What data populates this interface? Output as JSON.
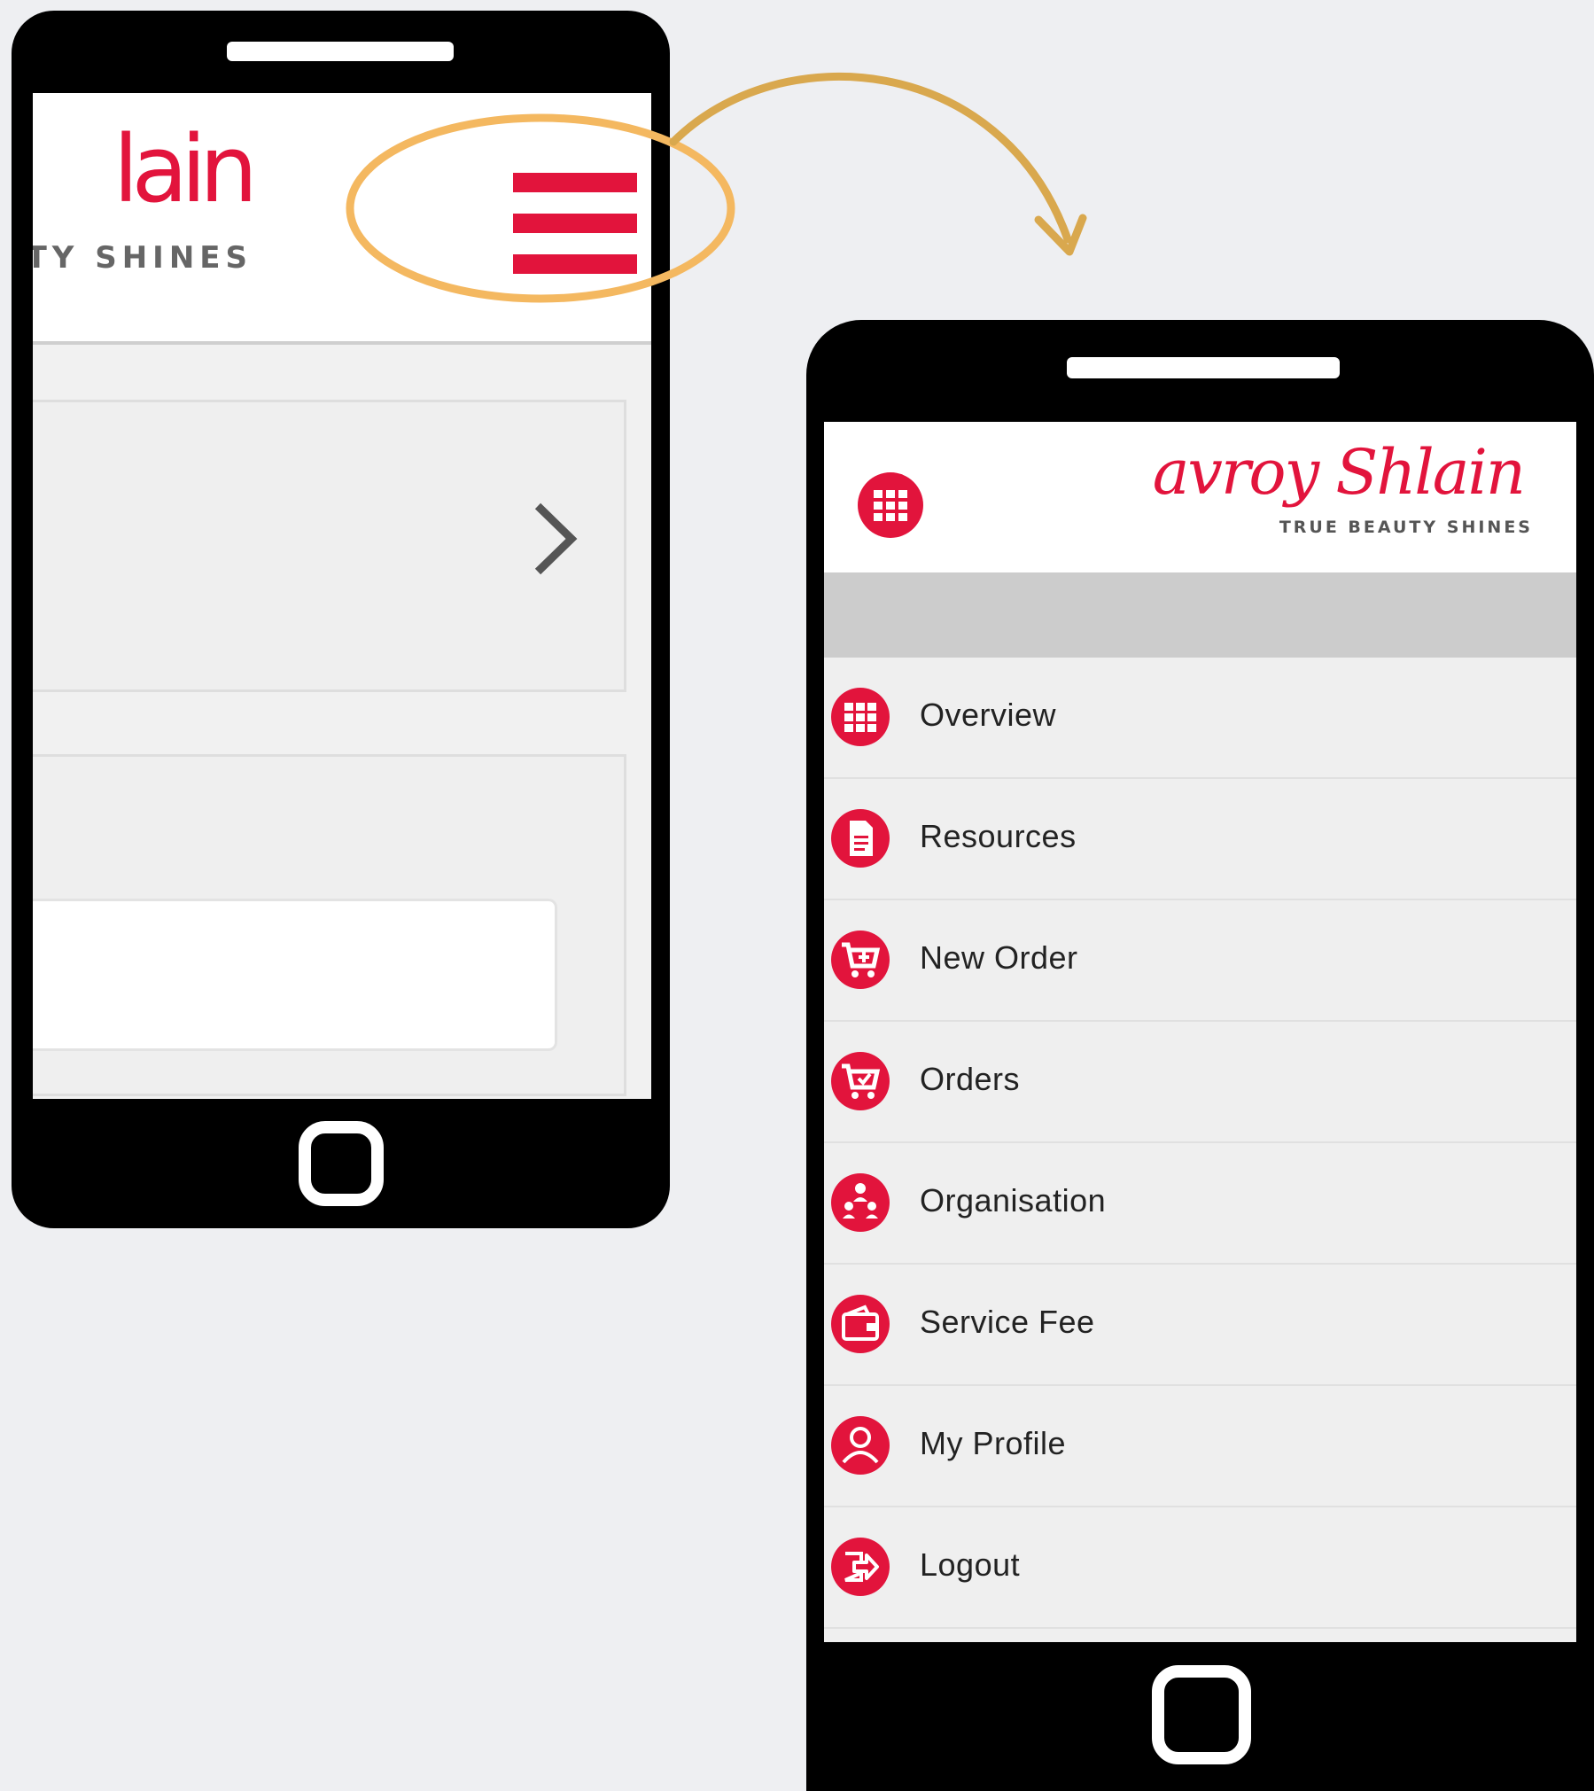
{
  "left_phone": {
    "logo_partial": "lain",
    "tagline_partial": "TY SHINES"
  },
  "right_phone": {
    "brand": "avroy Shlain",
    "tagline": "TRUE BEAUTY SHINES",
    "menu": [
      {
        "label": "Overview",
        "icon": "grid-icon"
      },
      {
        "label": "Resources",
        "icon": "document-icon"
      },
      {
        "label": "New Order",
        "icon": "cart-plus-icon"
      },
      {
        "label": "Orders",
        "icon": "cart-check-icon"
      },
      {
        "label": "Organisation",
        "icon": "organisation-icon"
      },
      {
        "label": "Service Fee",
        "icon": "wallet-icon"
      },
      {
        "label": "My Profile",
        "icon": "user-icon"
      },
      {
        "label": "Logout",
        "icon": "logout-icon"
      }
    ]
  },
  "colors": {
    "brand_red": "#e2143c",
    "annotation_orange": "#f4b860",
    "background": "#eeeff2"
  }
}
